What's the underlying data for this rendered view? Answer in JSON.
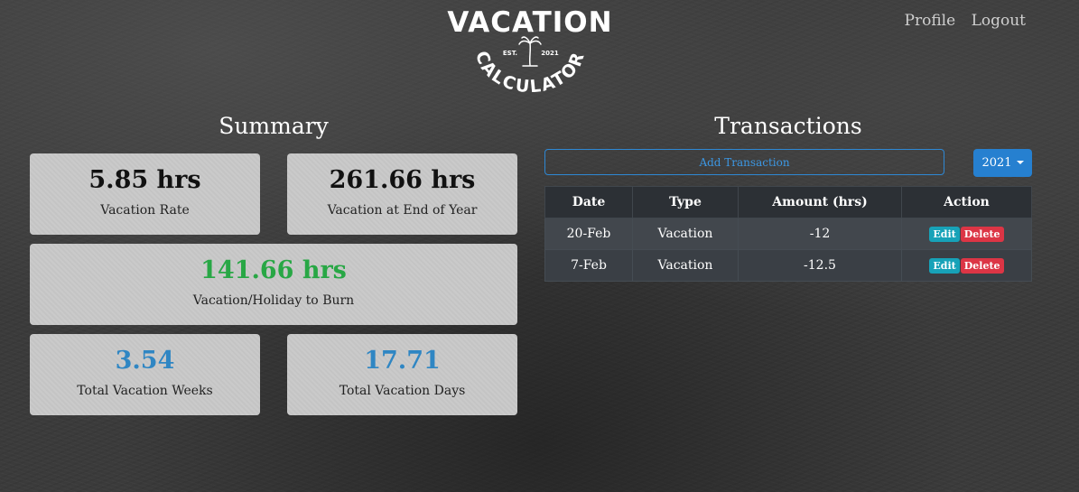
{
  "header": {
    "logo_main": "VACATION",
    "logo_sub": "CALCULATOR",
    "logo_est": "EST.",
    "logo_year": "2021",
    "nav": {
      "profile": "Profile",
      "logout": "Logout"
    }
  },
  "summary": {
    "title": "Summary",
    "vacation_rate": {
      "value": "5.85 hrs",
      "label": "Vacation Rate"
    },
    "end_of_year": {
      "value": "261.66 hrs",
      "label": "Vacation at End of Year"
    },
    "to_burn": {
      "value": "141.66 hrs",
      "label": "Vacation/Holiday to Burn"
    },
    "weeks": {
      "value": "3.54",
      "label": "Total Vacation Weeks"
    },
    "days": {
      "value": "17.71",
      "label": "Total Vacation Days"
    }
  },
  "transactions": {
    "title": "Transactions",
    "add_label": "Add Transaction",
    "year_label": "2021",
    "columns": [
      "Date",
      "Type",
      "Amount (hrs)",
      "Action"
    ],
    "rows": [
      {
        "date": "20-Feb",
        "type": "Vacation",
        "amount": "-12",
        "edit": "Edit",
        "delete": "Delete"
      },
      {
        "date": "7-Feb",
        "type": "Vacation",
        "amount": "-12.5",
        "edit": "Edit",
        "delete": "Delete"
      }
    ]
  },
  "colors": {
    "accent_blue": "#2680d0",
    "green_value": "#28a745",
    "blue_value": "#2f86c3",
    "edit": "#17a2b8",
    "delete": "#dc3545"
  }
}
